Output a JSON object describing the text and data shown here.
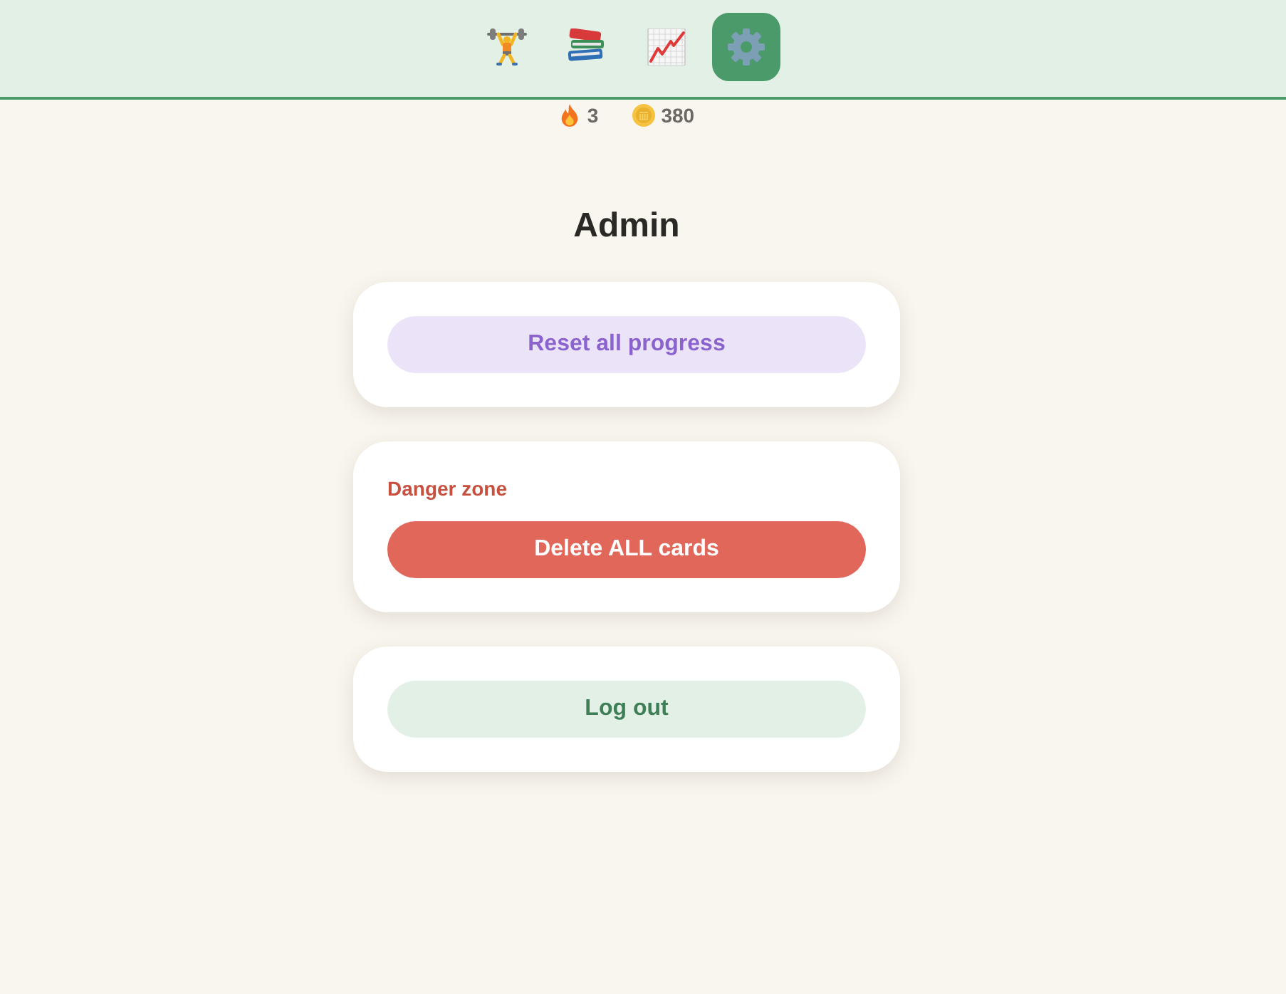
{
  "nav": [
    {
      "kind": "lifting",
      "selected": false
    },
    {
      "kind": "library",
      "selected": false
    },
    {
      "kind": "progress",
      "selected": false
    },
    {
      "kind": "settings",
      "selected": true
    }
  ],
  "stats": [
    {
      "kind": "streak",
      "value": "3"
    },
    {
      "kind": "coins",
      "value": "380"
    }
  ],
  "title": "Admin",
  "cards": [
    {
      "button": {
        "label": "Reset all progress",
        "kind": "accent"
      }
    },
    {
      "label": "Danger zone",
      "button": {
        "label": "Delete ALL cards",
        "kind": "danger"
      }
    },
    {
      "button": {
        "label": "Log out",
        "kind": "success"
      }
    }
  ]
}
